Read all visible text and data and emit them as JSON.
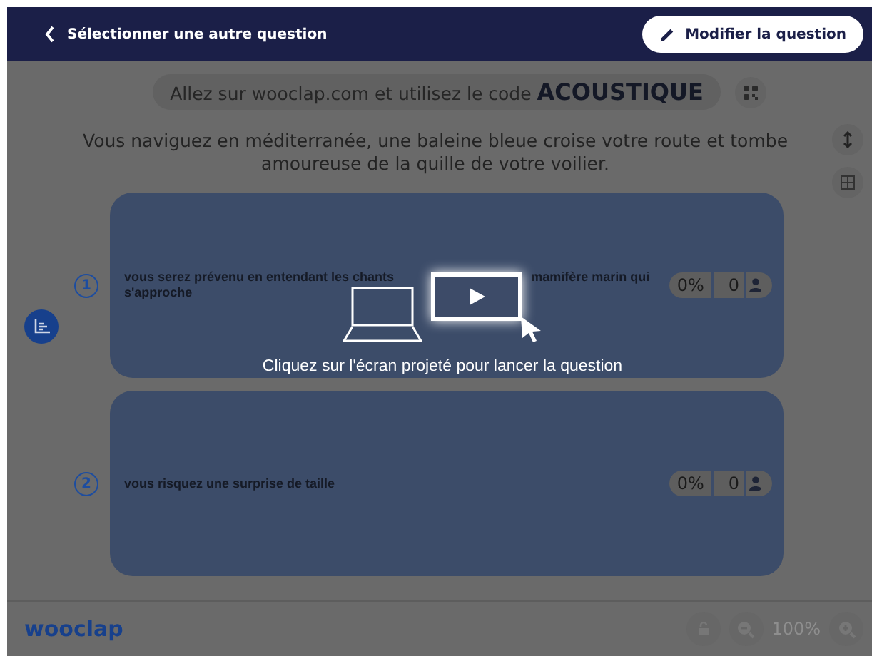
{
  "header": {
    "back_label": "Sélectionner une autre question",
    "edit_button": "Modifier la question"
  },
  "join": {
    "prefix": "Allez sur wooclap.com et utilisez le code",
    "code": "ACOUSTIQUE"
  },
  "question": "Vous naviguez en méditerranée,  une baleine bleue croise votre route et tombe amoureuse de la quille de votre voilier.",
  "answers": [
    {
      "number": "1",
      "lines": [
        [
          "vous serez prévenu en entendant les chants",
          "mamifère marin qui"
        ],
        [
          "s'approche"
        ]
      ],
      "percent": "0%",
      "count": "0"
    },
    {
      "number": "2",
      "lines": [
        [
          "vous risquez une surprise de taille"
        ]
      ],
      "percent": "0%",
      "count": "0"
    }
  ],
  "overlay": {
    "message": "Cliquez sur l'écran projeté pour lancer la question"
  },
  "footer": {
    "logo": "wooclap",
    "zoom": "100%"
  }
}
